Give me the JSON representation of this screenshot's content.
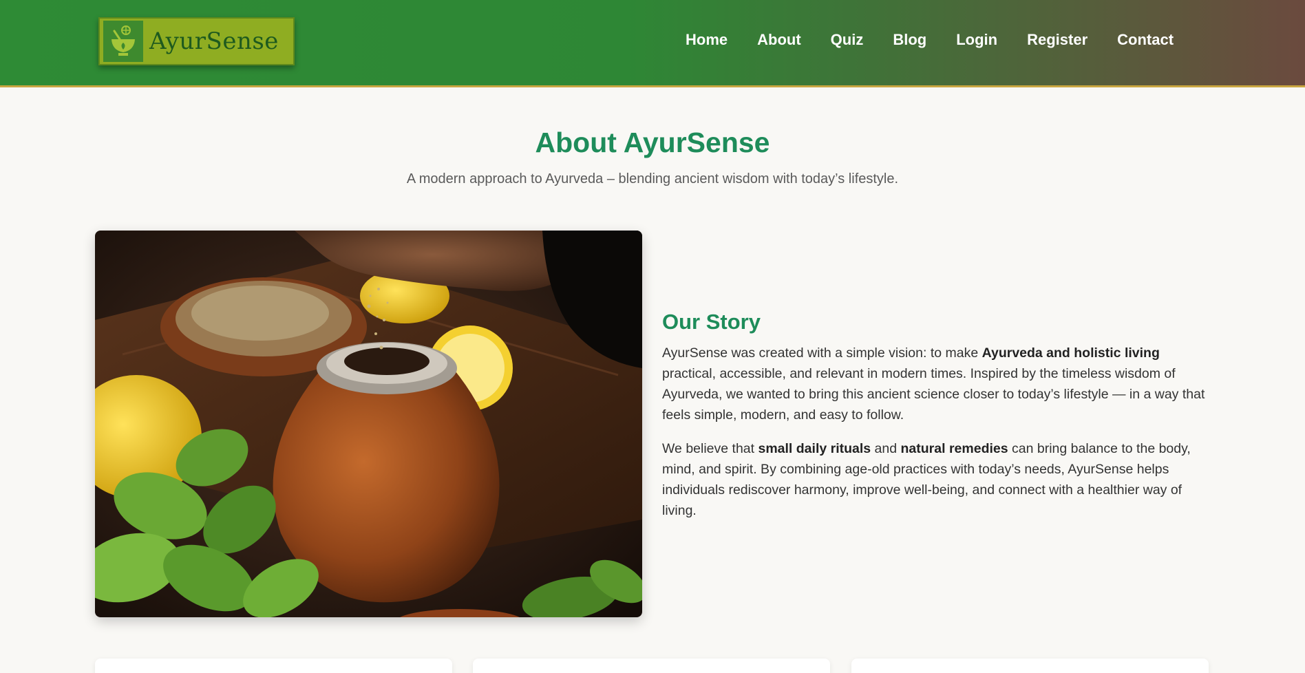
{
  "brand": {
    "name": "AyurSense",
    "logo_icon": "mortar-pestle-leaf-icon"
  },
  "nav": {
    "items": [
      {
        "label": "Home"
      },
      {
        "label": "About"
      },
      {
        "label": "Quiz"
      },
      {
        "label": "Blog"
      },
      {
        "label": "Login"
      },
      {
        "label": "Register"
      },
      {
        "label": "Contact"
      }
    ]
  },
  "hero": {
    "title": "About AyurSense",
    "subtitle": "A modern approach to Ayurveda – blending ancient wisdom with today’s lifestyle."
  },
  "story": {
    "heading": "Our Story",
    "p1": {
      "t1": "AyurSense was created with a simple vision: to make ",
      "b1": "Ayurveda and holistic living",
      "t2": " practical, accessible, and relevant in modern times. Inspired by the timeless wisdom of Ayurveda, we wanted to bring this ancient science closer to today’s lifestyle — in a way that feels simple, modern, and easy to follow."
    },
    "p2": {
      "t1": "We believe that ",
      "b1": "small daily rituals",
      "t2": " and ",
      "b2": "natural remedies",
      "t3": " can bring balance to the body, mind, and spirit. By combining age-old practices with today’s needs, AyurSense helps individuals rediscover harmony, improve well-being, and connect with a healthier way of living."
    }
  },
  "colors": {
    "header_green": "#2e8b35",
    "header_brown": "#6b4a3e",
    "accent_green": "#1e8c5a",
    "gold_border": "#c9a641"
  }
}
